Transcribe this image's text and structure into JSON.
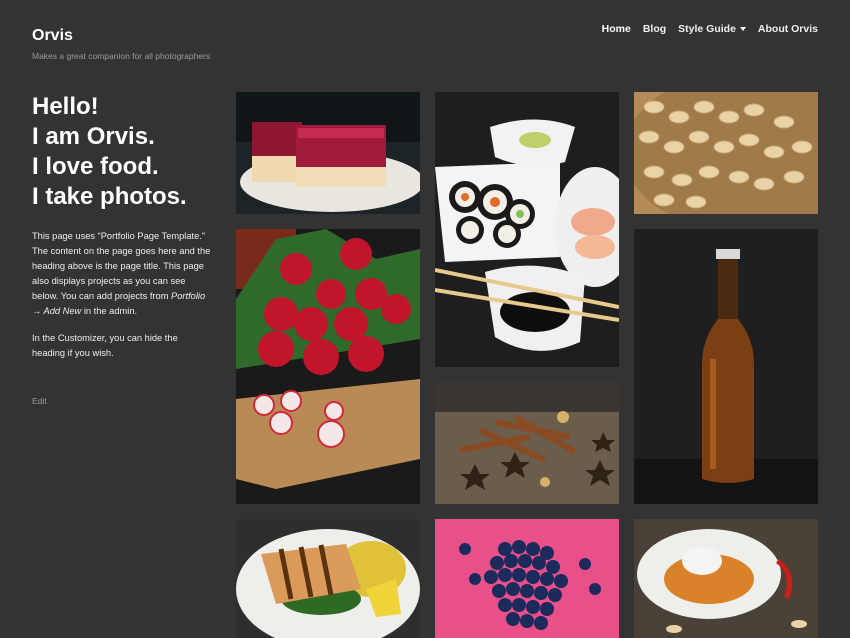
{
  "site": {
    "title": "Orvis",
    "tagline": "Makes a great companion for all photographers"
  },
  "nav": {
    "items": [
      {
        "label": "Home",
        "current": true
      },
      {
        "label": "Blog"
      },
      {
        "label": "Style Guide",
        "has_dropdown": true
      },
      {
        "label": "About Orvis"
      }
    ]
  },
  "headline": {
    "lines": [
      "Hello!",
      "I am Orvis.",
      "I love food.",
      "I take photos."
    ]
  },
  "body": {
    "p1_before": "This page uses “Portfolio Page Template.” The content on the page goes here and the heading above is the page title. This page also displays projects as you can see below. You can add projects from ",
    "p1_link": "Portfolio → Add New",
    "p1_after": " in the admin.",
    "p2": "In the Customizer, you can hide the heading if you wish."
  },
  "edit_label": "Edit",
  "portfolio": [
    {
      "name": "raspberry-cake"
    },
    {
      "name": "sushi"
    },
    {
      "name": "cashews"
    },
    {
      "name": "radishes"
    },
    {
      "name": "beer-bottle"
    },
    {
      "name": "cinnamon-spices"
    },
    {
      "name": "grilled-fish"
    },
    {
      "name": "blueberries"
    },
    {
      "name": "rice-curry"
    }
  ]
}
